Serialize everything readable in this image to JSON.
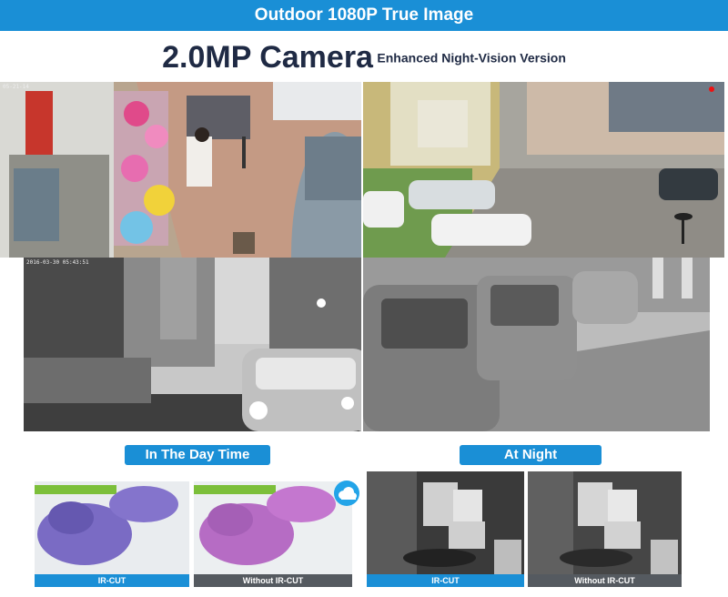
{
  "banner": {
    "title": "Outdoor 1080P True Image"
  },
  "headline": {
    "main": "2.0MP Camera",
    "sub": "Enhanced Night-Vision Version"
  },
  "osd": {
    "day_left": "05-21-14",
    "night_left": "2016-03-30  05:43:51"
  },
  "sections": {
    "day": "In The Day Time",
    "night": "At Night"
  },
  "captions": {
    "ir_cut": "IR-CUT",
    "without_ir_cut": "Without IR-CUT"
  },
  "colors": {
    "accent": "#1a8fd6",
    "headline": "#1f2a44",
    "cloud_badge": "#23a4e8"
  },
  "icons": {
    "cloud": "cloud-icon"
  }
}
